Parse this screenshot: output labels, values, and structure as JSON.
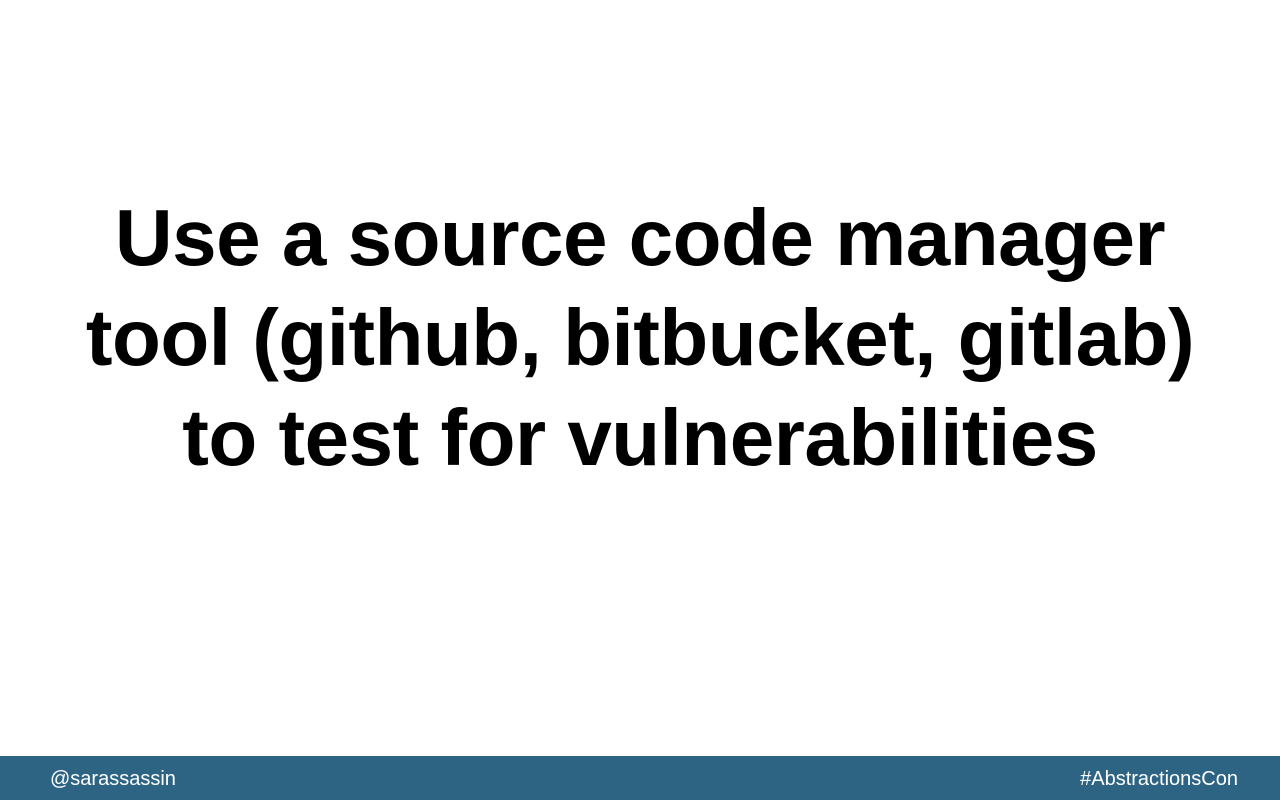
{
  "slide": {
    "title_lines": [
      "Use a source code manager",
      "tool (github, bitbucket, gitlab)",
      "to test for vulnerabilities"
    ]
  },
  "footer": {
    "handle": "@sarassassin",
    "hashtag": "#AbstractionsCon",
    "background_color": "#2d6484",
    "text_color": "#ffffff"
  }
}
